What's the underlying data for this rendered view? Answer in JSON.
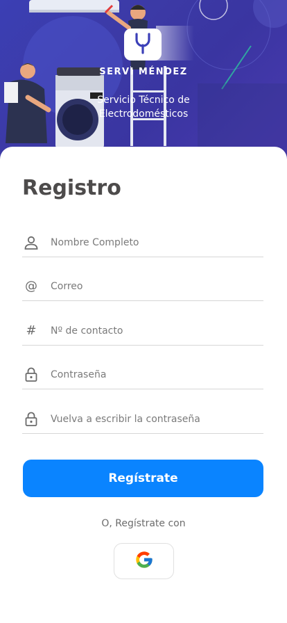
{
  "hero": {
    "brand": "SERVI MÉNDEZ",
    "tagline_line1": "Servicio Técnico de",
    "tagline_line2": "Electrodomésticos"
  },
  "form": {
    "title": "Registro",
    "fields": [
      {
        "icon": "person-icon",
        "placeholder": "Nombre Completo"
      },
      {
        "icon": "at-icon",
        "placeholder": "Correo"
      },
      {
        "icon": "hash-icon",
        "placeholder": "Nº de contacto"
      },
      {
        "icon": "lock-icon",
        "placeholder": "Contraseña"
      },
      {
        "icon": "lock-icon",
        "placeholder": "Vuelva a escribir la contraseña"
      }
    ],
    "submit_label": "Regístrate",
    "alt_label": "O, Regístrate con",
    "google_icon": "google-icon"
  },
  "colors": {
    "primary": "#0a84ff",
    "hero_bg": "#3b3fb4",
    "title": "#4d4b4b"
  }
}
